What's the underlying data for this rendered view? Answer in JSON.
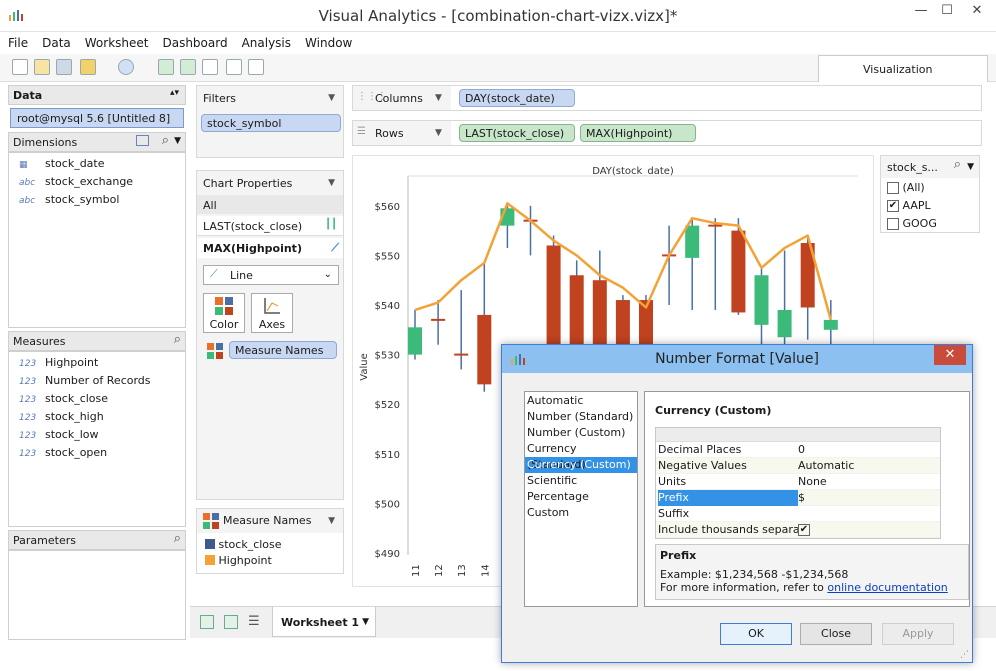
{
  "window": {
    "title": "Visual Analytics - [combination-chart-vizx.vizx]*"
  },
  "menu": [
    "File",
    "Data",
    "Worksheet",
    "Dashboard",
    "Analysis",
    "Window"
  ],
  "visualization_tab": "Visualization",
  "data_panel": {
    "header": "Data",
    "connection": "root@mysql 5.6 [Untitled 8]",
    "dimensions_header": "Dimensions",
    "dimensions": [
      {
        "icon": "date-icon",
        "label": "stock_date"
      },
      {
        "icon": "abc",
        "label": "stock_exchange"
      },
      {
        "icon": "abc",
        "label": "stock_symbol"
      }
    ],
    "measures_header": "Measures",
    "measures": [
      {
        "icon": "123",
        "label": "Highpoint"
      },
      {
        "icon": "123",
        "label": "Number of Records"
      },
      {
        "icon": "123",
        "label": "stock_close"
      },
      {
        "icon": "123",
        "label": "stock_high"
      },
      {
        "icon": "123",
        "label": "stock_low"
      },
      {
        "icon": "123",
        "label": "stock_open"
      }
    ],
    "parameters_header": "Parameters"
  },
  "filters": {
    "header": "Filters",
    "items": [
      "stock_symbol"
    ]
  },
  "chart_properties": {
    "header": "Chart Properties",
    "all_label": "All",
    "items": [
      "LAST(stock_close)",
      "MAX(Highpoint)"
    ],
    "mark_type": "Line",
    "color_label": "Color",
    "axes_label": "Axes",
    "measure_names_pill": "Measure Names"
  },
  "legend": {
    "header": "Measure Names",
    "items": [
      {
        "label": "stock_close",
        "color": "#3d5a8c"
      },
      {
        "label": "Highpoint",
        "color": "#f4a236"
      }
    ]
  },
  "shelves": {
    "columns_label": "Columns",
    "columns_pill": "DAY(stock_date)",
    "rows_label": "Rows",
    "rows_pills": [
      "LAST(stock_close)",
      "MAX(Highpoint)"
    ]
  },
  "symbol_filter": {
    "header": "stock_s...",
    "options": [
      {
        "label": "(All)",
        "checked": false
      },
      {
        "label": "AAPL",
        "checked": true
      },
      {
        "label": "GOOG",
        "checked": false
      }
    ]
  },
  "worksheet_tab": "Worksheet 1",
  "chart_data": {
    "type": "bar",
    "title": "DAY(stock_date)",
    "ylabel": "Value",
    "ylim": [
      490,
      565
    ],
    "yticks": [
      "$560",
      "$550",
      "$540",
      "$530",
      "$520",
      "$510",
      "$500",
      "$490"
    ],
    "x_tick_labels": [
      "11",
      "12",
      "13",
      "14"
    ],
    "colors": {
      "up": "#3cba7a",
      "down": "#c0421e",
      "highpoint": "#f4a236",
      "wick": "#4a6fa5"
    },
    "candles": [
      {
        "open": 530.0,
        "close": 535.5,
        "high": 539.0,
        "low": 529.0,
        "dir": "up"
      },
      {
        "open": 537.0,
        "close": 537.0,
        "high": 541.0,
        "low": 532.0,
        "dir": "flat"
      },
      {
        "open": 530.0,
        "close": 530.0,
        "high": 543.0,
        "low": 527.0,
        "dir": "flat"
      },
      {
        "open": 538.0,
        "close": 524.0,
        "high": 548.5,
        "low": 522.5,
        "dir": "down"
      },
      {
        "open": 556.0,
        "close": 559.5,
        "high": 560.5,
        "low": 551.5,
        "dir": "up"
      },
      {
        "open": 557.0,
        "close": 557.0,
        "high": 560.0,
        "low": 550.0,
        "dir": "flat"
      },
      {
        "open": 552.0,
        "close": 490.0,
        "high": 554.0,
        "low": 490.0,
        "dir": "down"
      },
      {
        "open": 546.0,
        "close": 490.0,
        "high": 549.0,
        "low": 490.0,
        "dir": "down"
      },
      {
        "open": 545.0,
        "close": 490.0,
        "high": 551.0,
        "low": 490.0,
        "dir": "down"
      },
      {
        "open": 541.0,
        "close": 490.0,
        "high": 542.0,
        "low": 490.0,
        "dir": "down"
      },
      {
        "open": 541.0,
        "close": 490.0,
        "high": 542.0,
        "low": 490.0,
        "dir": "down"
      },
      {
        "open": 550.0,
        "close": 550.0,
        "high": 556.0,
        "low": 540.0,
        "dir": "flat"
      },
      {
        "open": 549.5,
        "close": 556.0,
        "high": 557.5,
        "low": 539.0,
        "dir": "up"
      },
      {
        "open": 556.0,
        "close": 556.0,
        "high": 557.5,
        "low": 539.0,
        "dir": "flat"
      },
      {
        "open": 555.0,
        "close": 538.5,
        "high": 557.5,
        "low": 538.0,
        "dir": "down"
      },
      {
        "open": 536.0,
        "close": 546.0,
        "high": 547.5,
        "low": 530.0,
        "dir": "up"
      },
      {
        "open": 533.5,
        "close": 539.0,
        "high": 551.0,
        "low": 525.0,
        "dir": "up"
      },
      {
        "open": 552.5,
        "close": 539.5,
        "high": 554.0,
        "low": 533.0,
        "dir": "down"
      },
      {
        "open": 535.0,
        "close": 537.0,
        "high": 541.0,
        "low": 530.0,
        "dir": "up"
      }
    ],
    "highpoint_series": [
      539.0,
      540.5,
      545.0,
      548.5,
      560.5,
      557.0,
      553.0,
      550.0,
      546.0,
      543.5,
      539.5,
      550.0,
      557.5,
      556.5,
      556.0,
      547.5,
      551.5,
      554.0,
      537.0
    ]
  },
  "dialog": {
    "title": "Number Format [Value]",
    "formats": [
      "Automatic",
      "Number (Standard)",
      "Number (Custom)",
      "Currency (Standard)",
      "Currency (Custom)",
      "Scientific",
      "Percentage",
      "Custom"
    ],
    "selected_format_index": 4,
    "section_title": "Currency (Custom)",
    "properties": [
      {
        "key": "Decimal Places",
        "value": "0"
      },
      {
        "key": "Negative Values",
        "value": "Automatic"
      },
      {
        "key": "Units",
        "value": "None"
      },
      {
        "key": "Prefix",
        "value": "$"
      },
      {
        "key": "Suffix",
        "value": ""
      },
      {
        "key": "Include thousands separa...",
        "value": "✔"
      }
    ],
    "selected_property_index": 3,
    "help_title": "Prefix",
    "help_example": "Example: $1,234,568   -$1,234,568",
    "help_more": "For more information, refer to",
    "help_link": "online documentation",
    "ok_label": "OK",
    "close_label": "Close",
    "apply_label": "Apply"
  }
}
